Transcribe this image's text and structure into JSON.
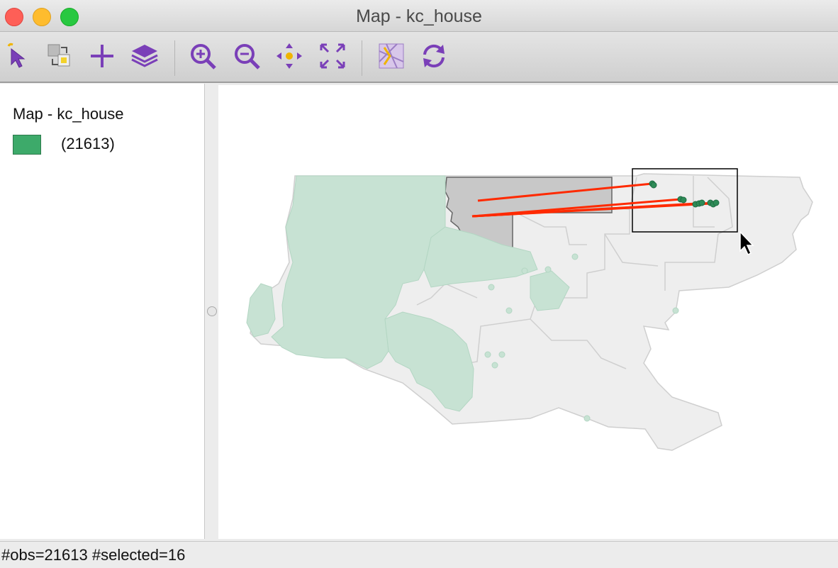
{
  "window": {
    "title": "Map - kc_house"
  },
  "toolbar": {
    "buttons": [
      {
        "name": "select-icon",
        "tooltip": ""
      },
      {
        "name": "selection-tool-icon",
        "tooltip": ""
      },
      {
        "name": "add-icon",
        "tooltip": ""
      },
      {
        "name": "layers-icon",
        "tooltip": ""
      },
      {
        "name": "zoom-in-icon",
        "tooltip": ""
      },
      {
        "name": "zoom-out-icon",
        "tooltip": ""
      },
      {
        "name": "pan-icon",
        "tooltip": ""
      },
      {
        "name": "fit-extent-icon",
        "tooltip": ""
      },
      {
        "name": "basemap-icon",
        "tooltip": ""
      },
      {
        "name": "refresh-icon",
        "tooltip": ""
      }
    ]
  },
  "legend": {
    "title": "Map - kc_house",
    "category_count": "(21613)",
    "swatch_color": "#3daa6a"
  },
  "status": {
    "text": "#obs=21613 #selected=16"
  },
  "colors": {
    "unselected_point": "#c7e2d3",
    "selected_point": "#2e8b57",
    "link_line": "#ff2a00",
    "region_fill": "#eeeeee",
    "highlight_region": "#c8c8c8"
  }
}
